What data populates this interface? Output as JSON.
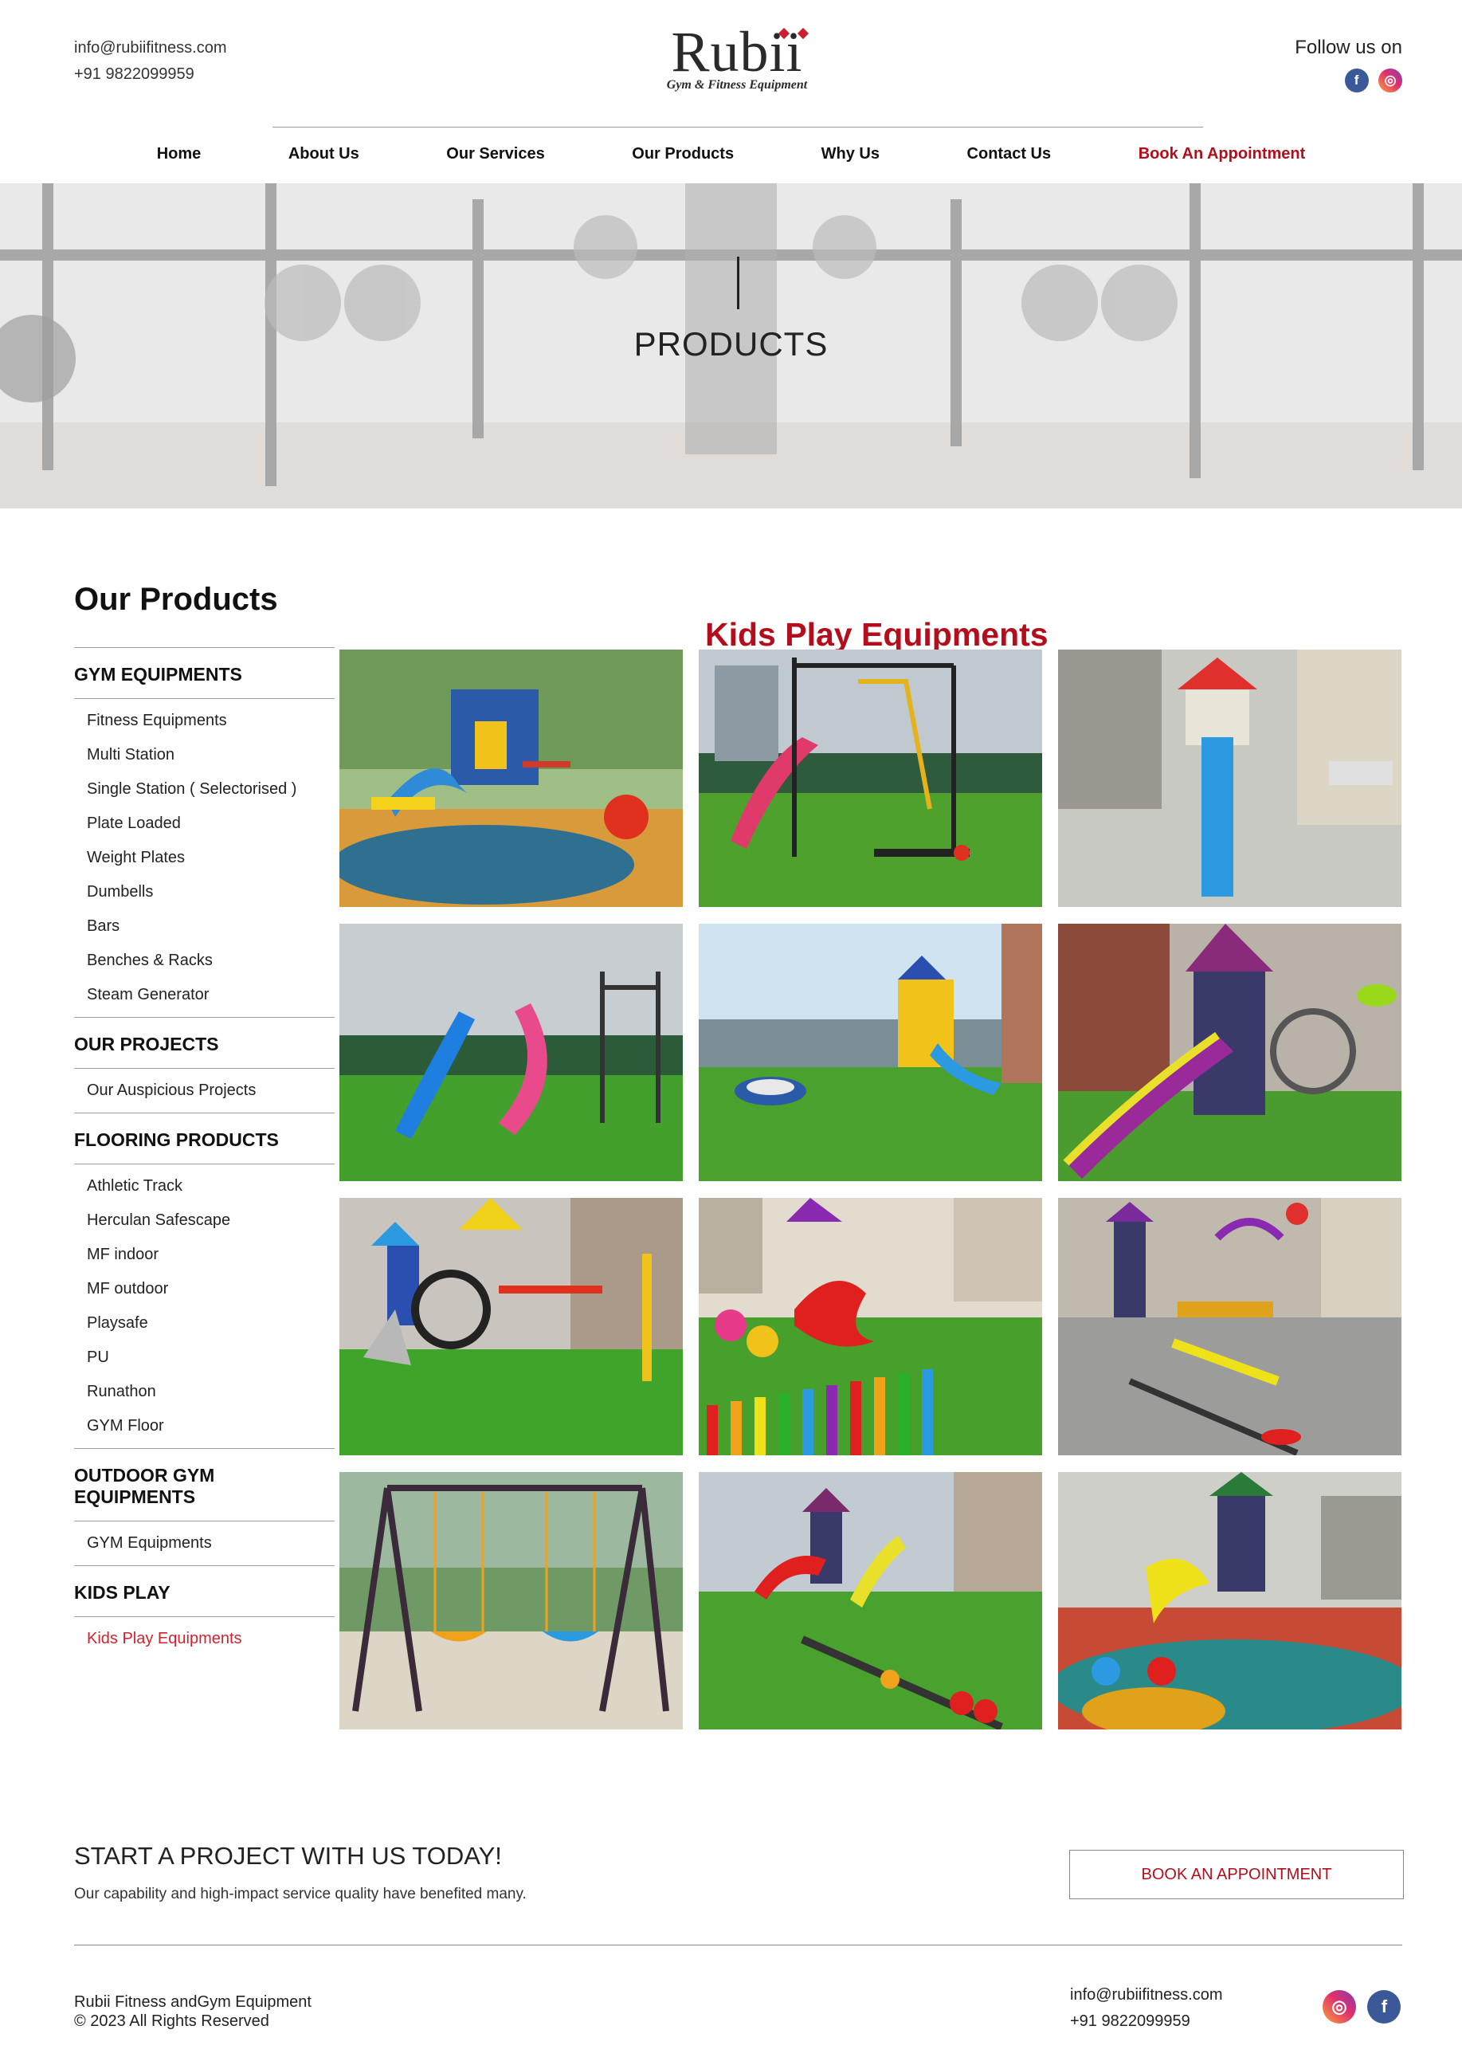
{
  "header": {
    "email": "info@rubiifitness.com",
    "phone": "+91 9822099959",
    "logo_word": "Rubii",
    "logo_tagline": "Gym & Fitness Equipment",
    "follow_label": "Follow us on"
  },
  "nav": {
    "home": "Home",
    "about": "About Us",
    "services": "Our Services",
    "products": "Our Products",
    "why": "Why Us",
    "contact": "Contact Us",
    "appointment": "Book An Appointment"
  },
  "hero": {
    "title": "PRODUCTS"
  },
  "sidebar": {
    "title": "Our Products",
    "categories": [
      {
        "title": "GYM EQUIPMENTS",
        "items": [
          "Fitness Equipments",
          "Multi Station",
          "Single Station ( Selectorised )",
          "Plate Loaded",
          "Weight Plates",
          "Dumbells",
          "Bars",
          "Benches & Racks",
          "Steam Generator"
        ]
      },
      {
        "title": "OUR PROJECTS",
        "items": [
          "Our Auspicious Projects"
        ]
      },
      {
        "title": "FLOORING PRODUCTS",
        "items": [
          "Athletic Track",
          "Herculan Safescape",
          "MF indoor",
          "MF outdoor",
          "Playsafe",
          "PU",
          "Runathon",
          "GYM Floor"
        ]
      },
      {
        "title": "OUTDOOR GYM EQUIPMENTS",
        "items": [
          "GYM Equipments"
        ]
      },
      {
        "title": "KIDS PLAY",
        "items": [
          "Kids Play Equipments"
        ]
      }
    ]
  },
  "section_title": "Kids Play Equipments",
  "cta": {
    "heading": "START A PROJECT WITH US TODAY!",
    "subtext": "Our capability and high-impact service quality have benefited many.",
    "button": "BOOK AN APPOINTMENT"
  },
  "footer": {
    "company": "Rubii Fitness andGym Equipment",
    "copyright": "© 2023 All Rights Reserved",
    "email": "info@rubiifitness.com",
    "phone": "+91 9822099959"
  },
  "colors": {
    "accent": "#b40e1c",
    "active_link": "#d0232f",
    "facebook": "#3b5998",
    "instagram": "#e1306c"
  },
  "icons": {
    "facebook": "facebook-icon",
    "instagram": "instagram-icon"
  }
}
